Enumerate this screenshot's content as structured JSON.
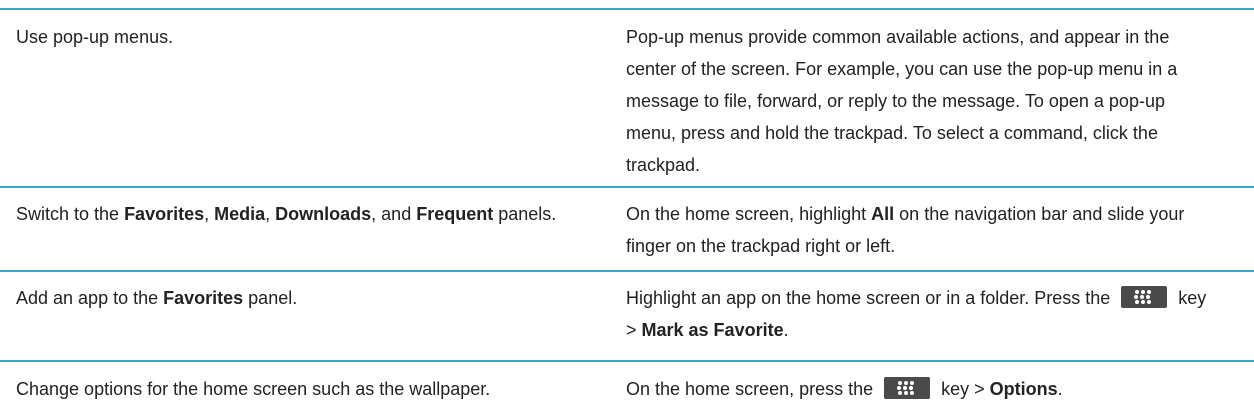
{
  "rows": [
    {
      "task": "Use pop-up menus.",
      "desc": "Pop-up menus provide common available actions, and appear in the center of the screen. For example, you can use the pop-up menu in a message to file, forward, or reply to the message. To open a pop-up menu, press and hold the trackpad. To select a command, click the trackpad."
    },
    {
      "task_parts": [
        "Switch to the ",
        "Favorites",
        ", ",
        "Media",
        ", ",
        "Downloads",
        ", and ",
        "Frequent",
        " panels."
      ],
      "desc_parts": [
        "On the home screen, highlight ",
        "All",
        " on the navigation bar and slide your finger on the trackpad right or left."
      ]
    },
    {
      "task_parts": [
        "Add an app to the ",
        "Favorites",
        " panel."
      ],
      "desc_parts": [
        "Highlight an app on the home screen or in a folder. Press the ",
        " key > ",
        "Mark as Favorite",
        "."
      ]
    },
    {
      "task": "Change options for the home screen such as the wallpaper.",
      "desc_parts": [
        "On the home screen, press the ",
        " key > ",
        "Options",
        "."
      ]
    }
  ],
  "colors": {
    "rule": "#3aa7c2",
    "key_bg": "#4a4a4a"
  },
  "icons": {
    "menu_key": "blackberry-menu-key-icon"
  }
}
